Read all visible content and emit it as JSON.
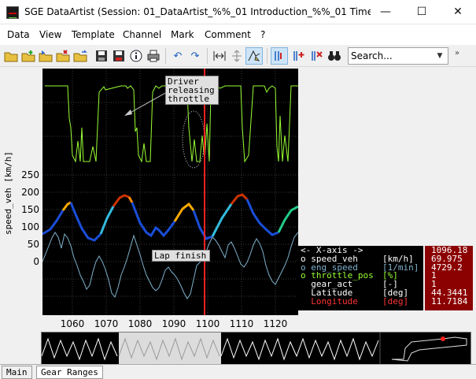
{
  "window": {
    "title": "SGE DataArtist (Session: 01_DataArtist_%%_01 Introduction_%%_01 Time analysis ...",
    "minimize": "—",
    "maximize": "☐",
    "close": "✕"
  },
  "menu": [
    "Data",
    "View",
    "Template",
    "Channel",
    "Mark",
    "Comment",
    "?"
  ],
  "toolbar": {
    "search_placeholder": "Search...",
    "icons": [
      "open-folder-icon",
      "new-folder-icon",
      "folder-add-icon",
      "folder-remove-icon",
      "folder-export-icon",
      "save-icon",
      "save-as-icon",
      "info-icon",
      "print-icon",
      "undo-icon",
      "redo-icon",
      "fit-horizontal-icon",
      "fit-vertical-icon",
      "cursor-mode-icon",
      "bar-cursor-icon",
      "add-channel-icon",
      "remove-channel-icon",
      "binoculars-icon"
    ]
  },
  "plot": {
    "y_axis_label": "speed_veh [km/h]",
    "y_ticks": [
      "250",
      "200",
      "150",
      "100",
      "50",
      "0"
    ],
    "x_ticks": [
      "1060",
      "1070",
      "1080",
      "1090",
      "1100",
      "1110",
      "1120"
    ],
    "annotations": {
      "driver": [
        "Driver",
        "releasing",
        "throttle"
      ],
      "lap": "Lap finish"
    },
    "colors": {
      "background": "#000000",
      "throttle": "#99ff33",
      "cursor": "#ff2222",
      "eng_speed": "#7fb2cc"
    }
  },
  "legend": {
    "rows": [
      {
        "name": "<- X-axis ->",
        "unit": "",
        "value": "1096.18",
        "color": "#ffffff"
      },
      {
        "name": "o speed_veh",
        "unit": "[km/h]",
        "value": "69.975",
        "color": "#ffffff"
      },
      {
        "name": "o eng_speed",
        "unit": "[1/min]",
        "value": "4729.2",
        "color": "#7fb2cc"
      },
      {
        "name": "o throttle_pos",
        "unit": "[%]",
        "value": "1",
        "color": "#99ff33"
      },
      {
        "name": "  gear_act",
        "unit": "[-]",
        "value": "1",
        "color": "#ffffff"
      },
      {
        "name": "  Latitude",
        "unit": "[deg]",
        "value": "44.3441",
        "color": "#ffffff"
      },
      {
        "name": "  Longitude",
        "unit": "[deg]",
        "value": "11.7184",
        "color": "#ff3333"
      }
    ]
  },
  "tabs": [
    "Main",
    "Gear Ranges"
  ]
}
